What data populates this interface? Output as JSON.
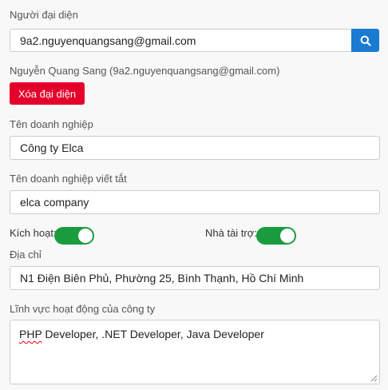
{
  "representative": {
    "label": "Người đại diện",
    "email_value": "9a2.nguyenquangsang@gmail.com",
    "selected_text": "Nguyễn Quang Sang (9a2.nguyenquangsang@gmail.com)",
    "delete_label": "Xóa đại diện",
    "search_icon": "search-icon"
  },
  "business_name": {
    "label": "Tên doanh nghiệp",
    "value": "Công ty Elca"
  },
  "short_name": {
    "label": "Tên doanh nghiệp viết tắt",
    "value": "elca company"
  },
  "toggles": {
    "active_label": "Kích hoạt:",
    "active_on": true,
    "sponsor_label": "Nhà tài trợ:",
    "sponsor_on": true
  },
  "address": {
    "label": "Địa chỉ",
    "value": "N1 Điện Biên Phủ, Phường 25, Bình Thạnh, Hồ Chí Minh"
  },
  "field": {
    "label": "Lĩnh vực hoạt động của công ty",
    "value_first_word": "PHP",
    "value_rest": " Developer, .NET Developer, Java Developer"
  },
  "colors": {
    "accent": "#1a7bd1",
    "danger": "#e4002b",
    "toggle_on": "#1a9c3e"
  }
}
